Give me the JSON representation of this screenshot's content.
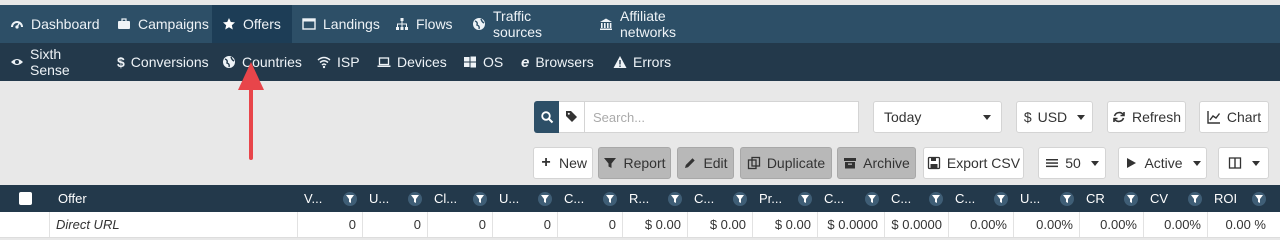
{
  "top_nav": [
    {
      "label": "Dashboard",
      "icon": "dashboard-icon"
    },
    {
      "label": "Campaigns",
      "icon": "briefcase-icon"
    },
    {
      "label": "Offers",
      "icon": "star-icon"
    },
    {
      "label": "Landings",
      "icon": "window-icon"
    },
    {
      "label": "Flows",
      "icon": "sitemap-icon"
    },
    {
      "label": "Traffic sources",
      "icon": "globe-icon"
    },
    {
      "label": "Affiliate networks",
      "icon": "bank-icon"
    }
  ],
  "active_top": "Offers",
  "sub_nav": [
    {
      "label": "Sixth Sense",
      "icon": "eye-icon"
    },
    {
      "label": "Conversions",
      "icon": "dollar-icon"
    },
    {
      "label": "Countries",
      "icon": "globe-icon"
    },
    {
      "label": "ISP",
      "icon": "wifi-icon"
    },
    {
      "label": "Devices",
      "icon": "laptop-icon"
    },
    {
      "label": "OS",
      "icon": "windows-icon"
    },
    {
      "label": "Browsers",
      "icon": "browser-icon"
    },
    {
      "label": "Errors",
      "icon": "warning-icon"
    }
  ],
  "toolbar": {
    "search_placeholder": "Search...",
    "date_range": "Today",
    "currency": "USD",
    "currency_symbol": "$",
    "refresh": "Refresh",
    "chart": "Chart",
    "new": "New",
    "report": "Report",
    "edit": "Edit",
    "duplicate": "Duplicate",
    "archive": "Archive",
    "export_csv": "Export CSV",
    "page_size": "50",
    "status": "Active"
  },
  "table": {
    "columns": [
      "Offer",
      "V...",
      "U...",
      "Cl...",
      "U...",
      "C...",
      "R...",
      "C...",
      "Pr...",
      "C...",
      "C...",
      "C...",
      "U...",
      "CR",
      "CV",
      "ROI"
    ],
    "rows": [
      {
        "name": "Direct URL",
        "values": [
          "0",
          "0",
          "0",
          "0",
          "0",
          "$ 0.00",
          "$ 0.00",
          "$ 0.00",
          "$ 0.0000",
          "$ 0.0000",
          "0.00%",
          "0.00%",
          "0.00%",
          "0.00%",
          "0.00 %"
        ]
      }
    ]
  },
  "colors": {
    "nav": "#2d4f67",
    "subnav": "#23394b",
    "annotation_arrow": "#e8454a"
  }
}
